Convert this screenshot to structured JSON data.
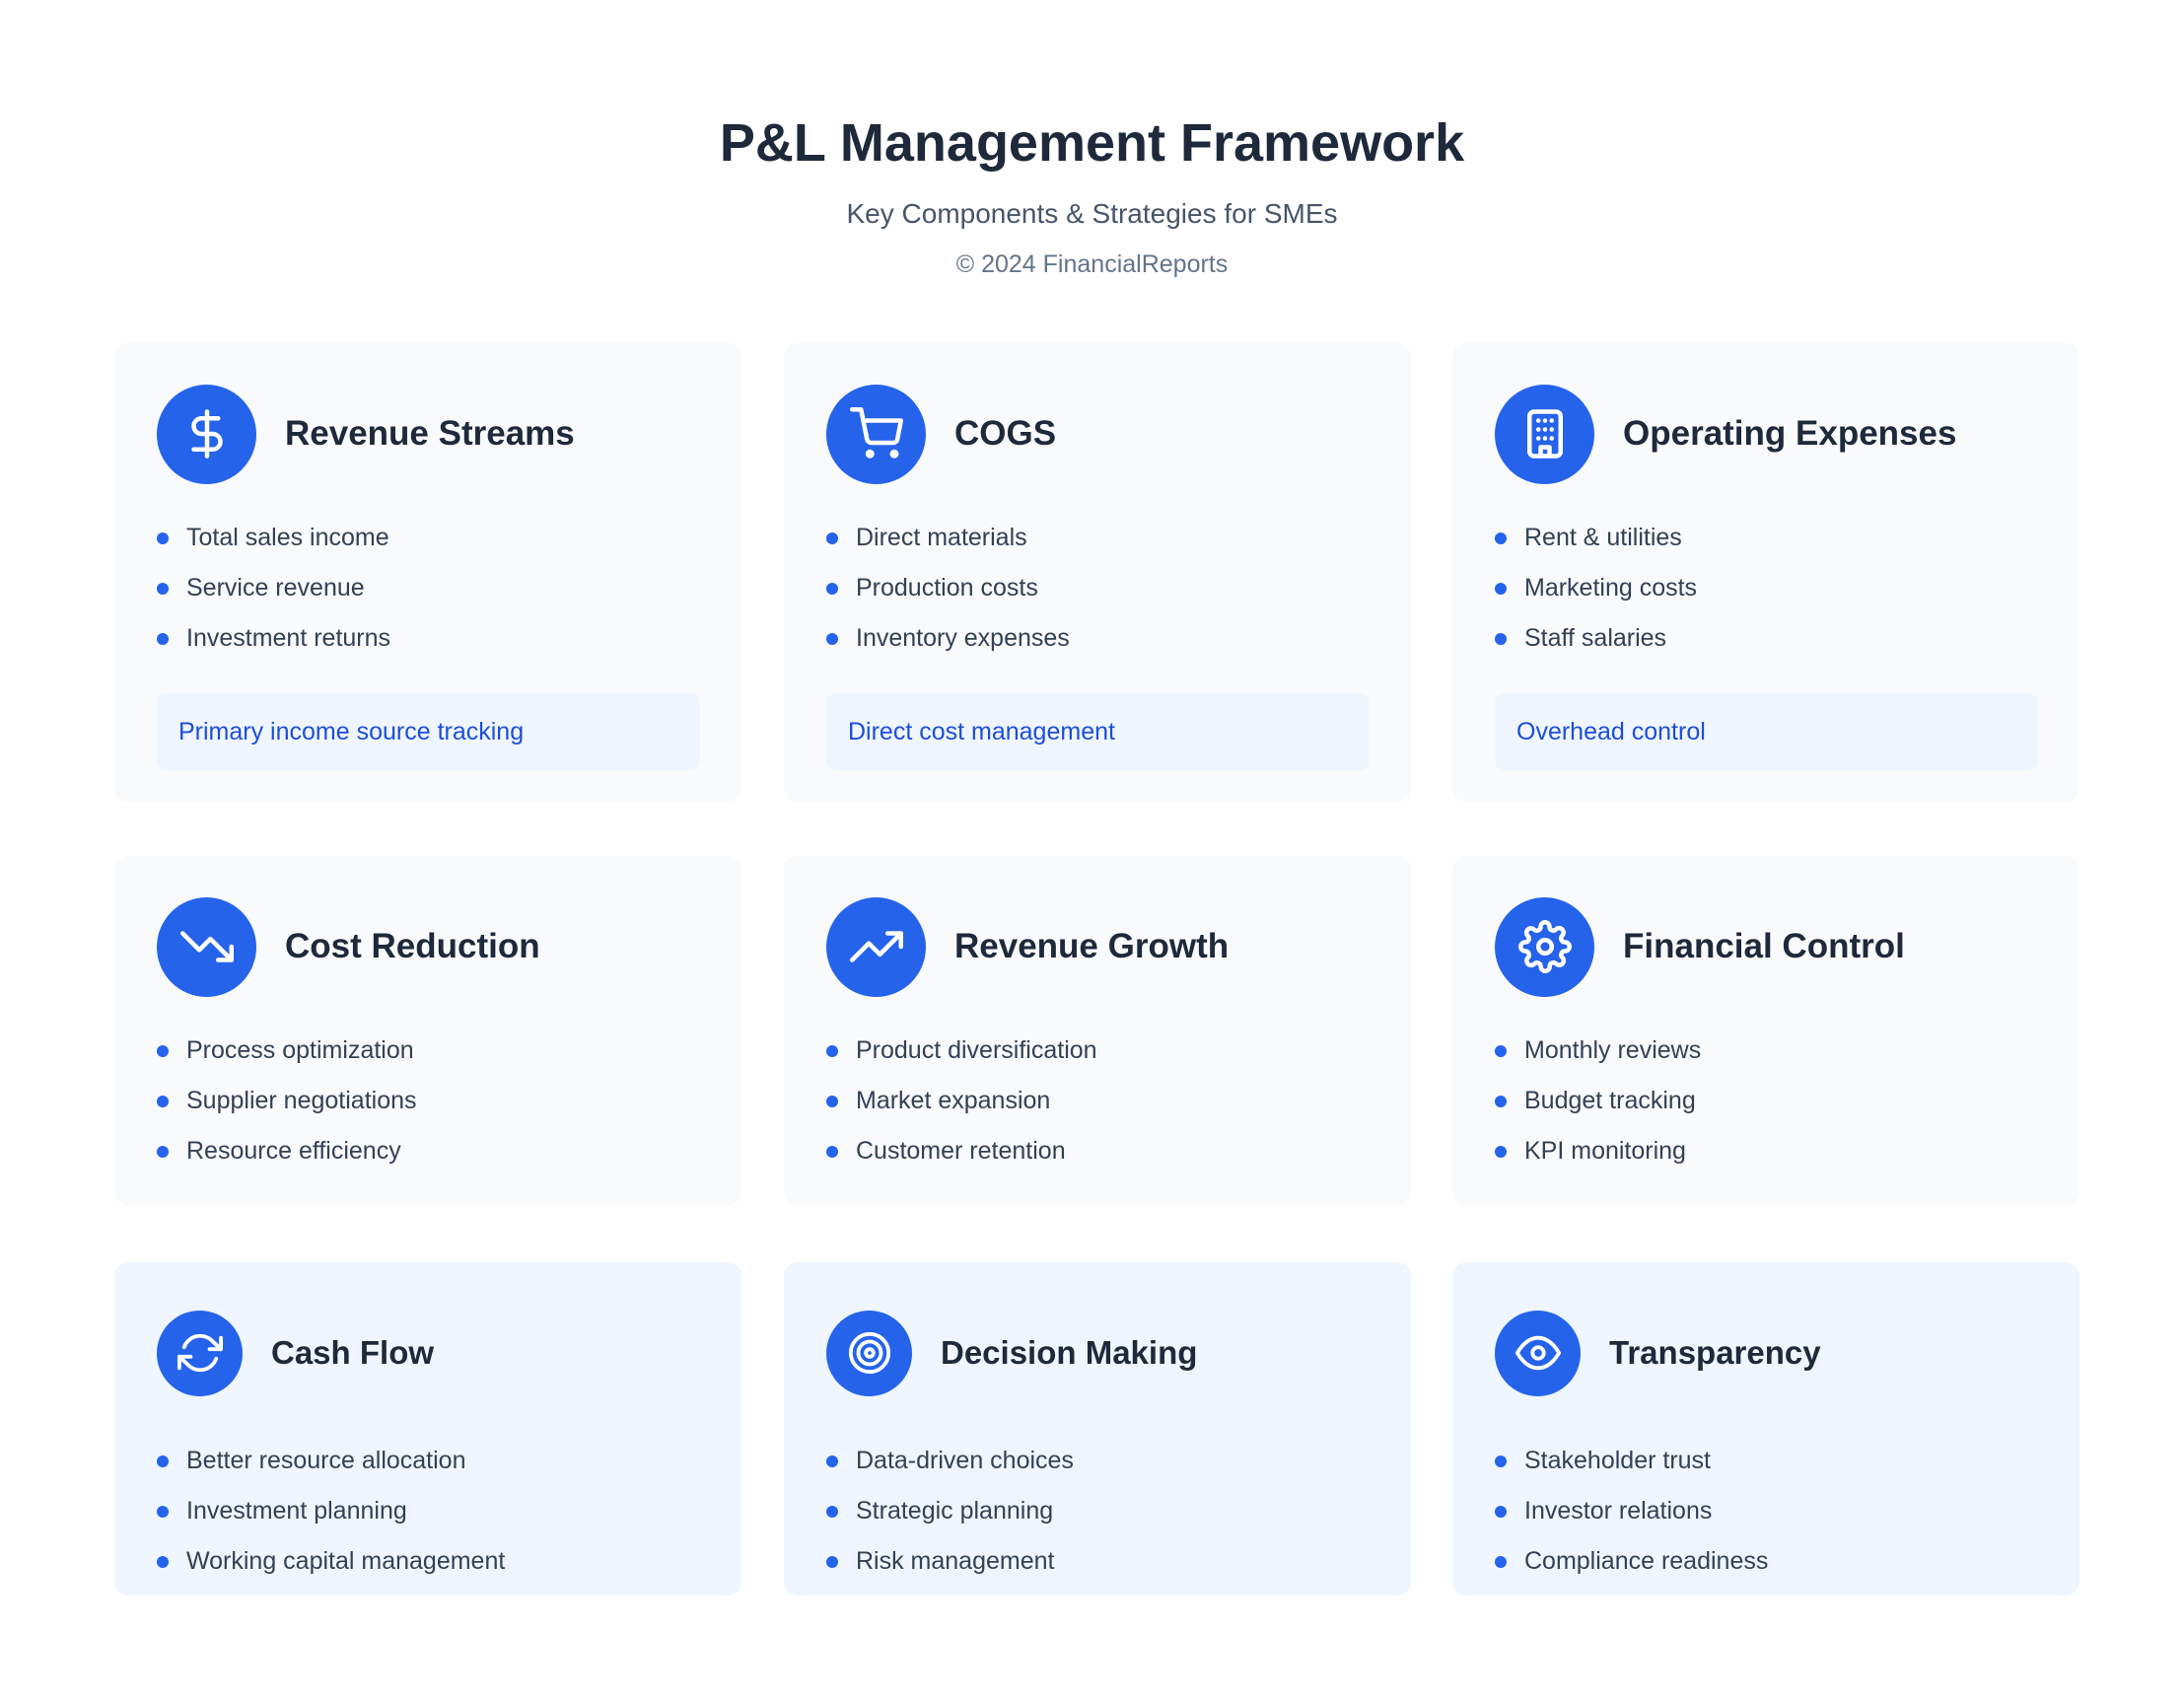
{
  "header": {
    "title": "P&L Management Framework",
    "subtitle": "Key Components & Strategies for SMEs",
    "copyright": "© 2024 FinancialReports"
  },
  "colors": {
    "accent": "#2563eb",
    "card_background": "#f8fafc",
    "highlight_background": "#eff6ff",
    "note_text": "#1d4ed8"
  },
  "components": [
    {
      "icon": "dollar-sign-icon",
      "title": "Revenue Streams",
      "items": [
        "Total sales income",
        "Service revenue",
        "Investment returns"
      ],
      "note": "Primary income source tracking"
    },
    {
      "icon": "shopping-cart-icon",
      "title": "COGS",
      "items": [
        "Direct materials",
        "Production costs",
        "Inventory expenses"
      ],
      "note": "Direct cost management"
    },
    {
      "icon": "building-icon",
      "title": "Operating Expenses",
      "items": [
        "Rent & utilities",
        "Marketing costs",
        "Staff salaries"
      ],
      "note": "Overhead control"
    }
  ],
  "strategies": [
    {
      "icon": "trending-down-icon",
      "title": "Cost Reduction",
      "items": [
        "Process optimization",
        "Supplier negotiations",
        "Resource efficiency"
      ]
    },
    {
      "icon": "trending-up-icon",
      "title": "Revenue Growth",
      "items": [
        "Product diversification",
        "Market expansion",
        "Customer retention"
      ]
    },
    {
      "icon": "gear-icon",
      "title": "Financial Control",
      "items": [
        "Monthly reviews",
        "Budget tracking",
        "KPI monitoring"
      ]
    }
  ],
  "benefits": [
    {
      "icon": "refresh-icon",
      "title": "Cash Flow",
      "items": [
        "Better resource allocation",
        "Investment planning",
        "Working capital management"
      ]
    },
    {
      "icon": "target-icon",
      "title": "Decision Making",
      "items": [
        "Data-driven choices",
        "Strategic planning",
        "Risk management"
      ]
    },
    {
      "icon": "eye-icon",
      "title": "Transparency",
      "items": [
        "Stakeholder trust",
        "Investor relations",
        "Compliance readiness"
      ]
    }
  ]
}
